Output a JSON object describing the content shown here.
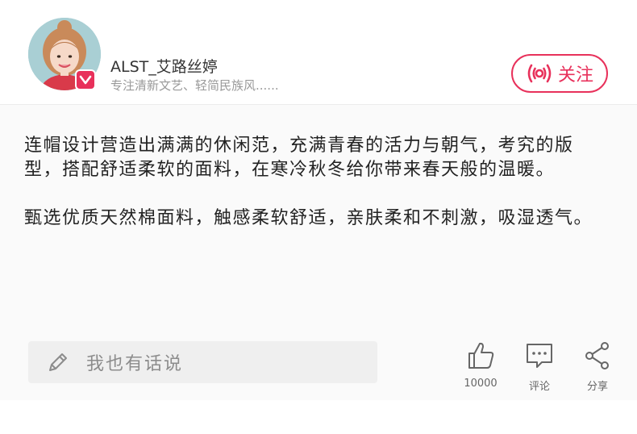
{
  "author": {
    "name": "ALST_艾路丝婷",
    "bio": "专注清新文艺、轻简民族风......"
  },
  "follow": {
    "label": "关注"
  },
  "post": {
    "paragraphs": [
      "连帽设计营造出满满的休闲范，充满青春的活力与朝气，考究的版型，搭配舒适柔软的面料，在寒冷秋冬给你带来春天般的温暖。",
      "甄选优质天然棉面料，触感柔软舒适，亲肤柔和不刺激，吸湿透气。"
    ]
  },
  "comment_input": {
    "placeholder": "我也有话说"
  },
  "actions": {
    "like": {
      "icon": "thumbs-up-icon",
      "count": "10000"
    },
    "comment": {
      "icon": "comment-bubble-icon",
      "label": "评论"
    },
    "share": {
      "icon": "share-icon",
      "label": "分享"
    }
  },
  "colors": {
    "accent": "#e8315b",
    "text": "#222222",
    "muted": "#999999"
  }
}
